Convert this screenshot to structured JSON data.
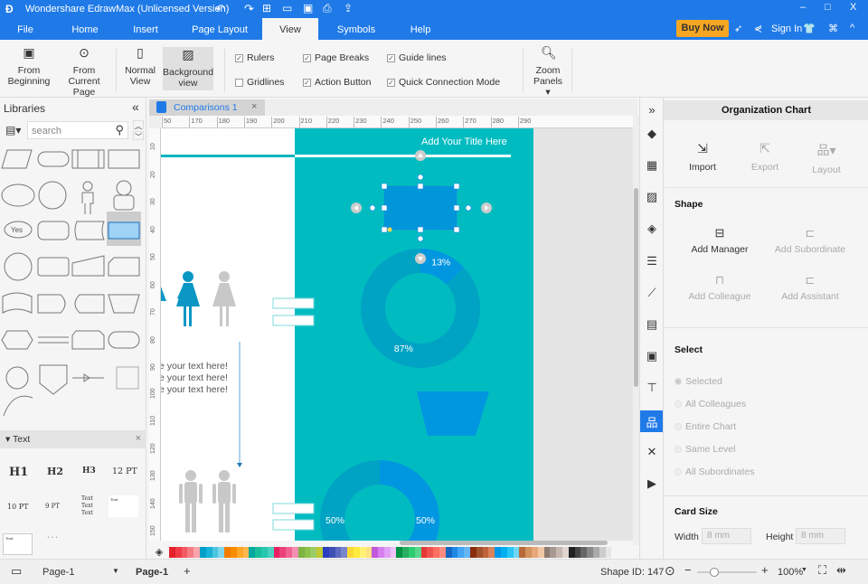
{
  "app": {
    "title": "Wondershare EdrawMax (Unlicensed Version)",
    "buy_now": "Buy Now",
    "sign_in": "Sign In"
  },
  "menu_tabs": [
    "File",
    "Home",
    "Insert",
    "Page Layout",
    "View",
    "Symbols",
    "Help"
  ],
  "active_tab": "View",
  "ribbon": {
    "from_beginning": "From Beginning",
    "from_current_page": "From Current Page",
    "normal_view": "Normal View",
    "background_view": "Background view",
    "checks": [
      {
        "label": "Rulers",
        "checked": true
      },
      {
        "label": "Page Breaks",
        "checked": true
      },
      {
        "label": "Guide lines",
        "checked": true
      },
      {
        "label": "Gridlines",
        "checked": false
      },
      {
        "label": "Action Button",
        "checked": true
      },
      {
        "label": "Quick Connection Mode",
        "checked": true
      }
    ],
    "zoom": "Zoom",
    "panels": "Panels"
  },
  "libraries": {
    "title": "Libraries",
    "search_placeholder": "search",
    "yes_label": "Yes",
    "text_section": "Text",
    "text_items": [
      "H1",
      "H2",
      "H3",
      "12 PT",
      "10 PT",
      "9 PT"
    ],
    "text_sample": "Text"
  },
  "document": {
    "tab": "Comparisons 1",
    "ruler_top": [
      "50",
      "170",
      "180",
      "190",
      "200",
      "210",
      "220",
      "230",
      "240",
      "250",
      "260",
      "270",
      "280",
      "290"
    ],
    "ruler_left": [
      "10",
      "20",
      "30",
      "40",
      "50",
      "60",
      "70",
      "80",
      "90",
      "100",
      "110",
      "120",
      "130",
      "140",
      "150"
    ],
    "title_text": "Add Your Title Here",
    "body_text": [
      "e your text here!",
      "e your text here!",
      "e your text here!"
    ],
    "chart_data": [
      {
        "type": "pie",
        "values": [
          13,
          87
        ],
        "labels": [
          "13%",
          "87%"
        ]
      },
      {
        "type": "pie",
        "values": [
          50,
          50
        ],
        "labels": [
          "50%",
          "50%"
        ]
      }
    ],
    "colors": {
      "teal": "#00bcc1",
      "blue": "#0096e0",
      "dark_teal": "#00a3c4"
    }
  },
  "palette": [
    "#e4202a",
    "#ee3b45",
    "#f25a64",
    "#f47c85",
    "#f9a3aa",
    "#00a0c8",
    "#19b2d6",
    "#4cc4e2",
    "#80d6ec",
    "#f57c00",
    "#fb8c00",
    "#ffa726",
    "#ffb74d",
    "#00a99d",
    "#1abc9c",
    "#26c6b0",
    "#4dd0c0",
    "#e91e63",
    "#ec407a",
    "#f06292",
    "#f48fb1",
    "#7cb342",
    "#8bc34a",
    "#9ccc65",
    "#c0ca33",
    "#2a3fbf",
    "#3f51b5",
    "#5c6bc0",
    "#7986cb",
    "#fdd835",
    "#ffeb3b",
    "#fff176",
    "#ffe082",
    "#c158dc",
    "#d67ef0",
    "#e1a0f5",
    "#ecc4f8",
    "#009245",
    "#27ae60",
    "#2ecc71",
    "#58d68d",
    "#e53935",
    "#ef5350",
    "#ff6f61",
    "#ff8a80",
    "#1565c0",
    "#1e88e5",
    "#42a5f5",
    "#64b5f6",
    "#8b2e0b",
    "#a0522d",
    "#c0623a",
    "#d9825b",
    "#0097e6",
    "#00b0f0",
    "#29c5f6",
    "#6fd6fa",
    "#b86a3a",
    "#d2915e",
    "#e6a77a",
    "#f2c7a6",
    "#8d7b72",
    "#a89a92",
    "#c4b8b1",
    "#e0d6cf",
    "#222222",
    "#444444",
    "#666666",
    "#888888",
    "#aaaaaa",
    "#cccccc",
    "#e6e6e6"
  ],
  "status": {
    "page_select": "Page-1",
    "page_tab": "Page-1",
    "shape_id": "Shape ID: 147",
    "zoom": "100%",
    "zoom_level": 100
  },
  "right_panel": {
    "title": "Organization Chart",
    "import": "Import",
    "export": "Export",
    "layout": "Layout",
    "shape_heading": "Shape",
    "add_manager": "Add Manager",
    "add_subordinate": "Add Subordinate",
    "add_colleague": "Add Colleague",
    "add_assistant": "Add Assistant",
    "select_heading": "Select",
    "select_options": [
      "Selected",
      "All Colleagues",
      "Entire Chart",
      "Same Level",
      "All Subordinates"
    ],
    "card_size_heading": "Card Size",
    "width_label": "Width",
    "width_value": "8 mm",
    "height_label": "Height",
    "height_value": "8 mm"
  }
}
